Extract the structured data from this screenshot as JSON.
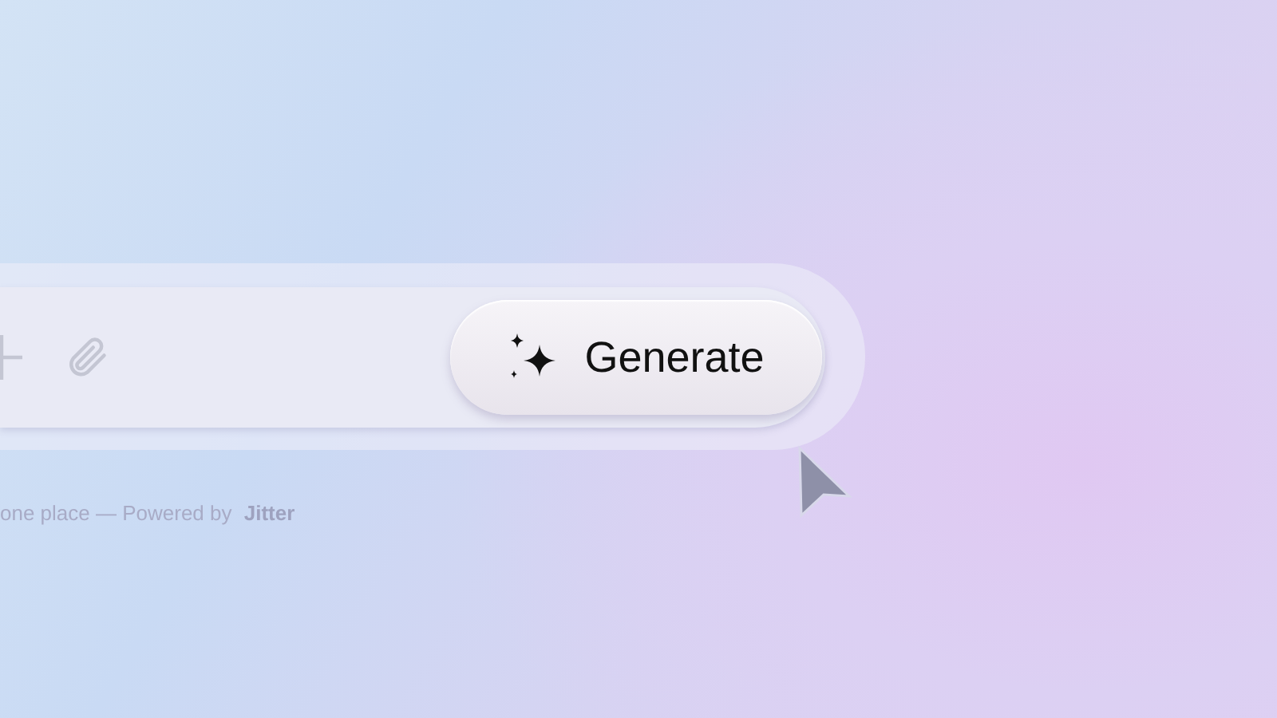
{
  "prompt_bar": {
    "generate_button": {
      "label": "Generate"
    }
  },
  "footer": {
    "text": "one place — Powered by **Jitter**"
  }
}
